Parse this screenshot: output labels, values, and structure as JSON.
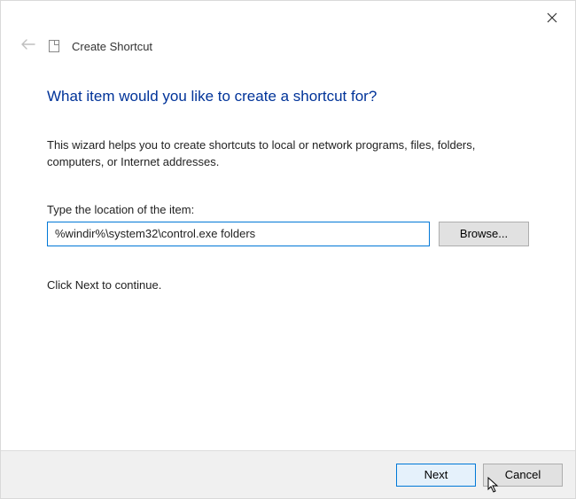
{
  "header": {
    "title": "Create Shortcut"
  },
  "main": {
    "heading": "What item would you like to create a shortcut for?",
    "description": "This wizard helps you to create shortcuts to local or network programs, files, folders, computers, or Internet addresses.",
    "location_label": "Type the location of the item:",
    "location_value": "%windir%\\system32\\control.exe folders",
    "browse_label": "Browse...",
    "continue_text": "Click Next to continue."
  },
  "footer": {
    "next_label": "Next",
    "cancel_label": "Cancel"
  }
}
